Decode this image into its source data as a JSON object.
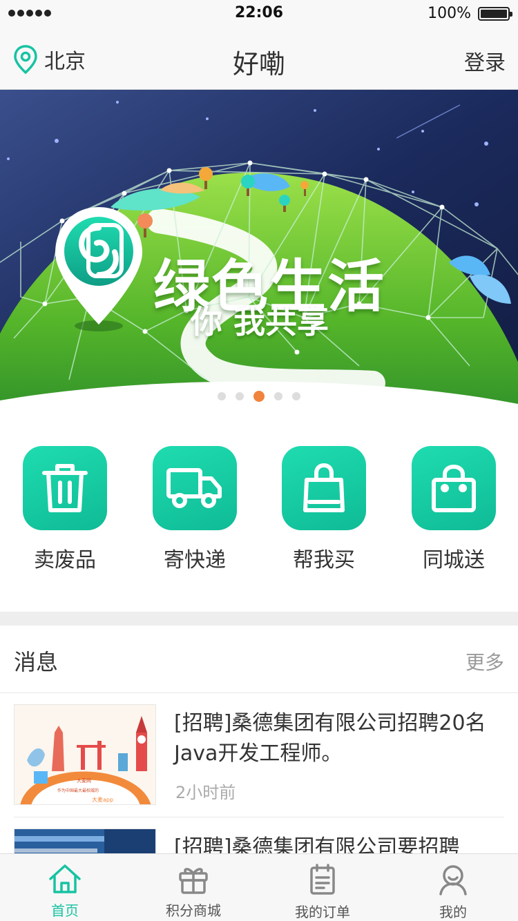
{
  "status_bar": {
    "time": "22:06",
    "battery": "100%"
  },
  "nav": {
    "location": "北京",
    "title": "好嘞",
    "login": "登录"
  },
  "banner": {
    "headline": "绿色生活",
    "subline": "你 我共享",
    "dots_total": 5,
    "active_dot": 3
  },
  "services": [
    {
      "label": "卖废品",
      "icon": "trash-icon"
    },
    {
      "label": "寄快递",
      "icon": "truck-icon"
    },
    {
      "label": "帮我买",
      "icon": "shopping-bag-icon"
    },
    {
      "label": "同城送",
      "icon": "box-bag-icon"
    }
  ],
  "messages": {
    "title": "消息",
    "more": "更多",
    "items": [
      {
        "text": "[招聘]桑德集团有限公司招聘20名Java开发工程师。",
        "time": "2小时前"
      },
      {
        "text": "[招聘]桑德集团有限公司要招聘",
        "time": ""
      }
    ]
  },
  "tabbar": {
    "active": "首页",
    "items": [
      {
        "label": "首页",
        "icon": "home-icon"
      },
      {
        "label": "积分商城",
        "icon": "gift-icon"
      },
      {
        "label": "我的订单",
        "icon": "order-list-icon"
      },
      {
        "label": "我的",
        "icon": "user-icon"
      }
    ]
  },
  "colors": {
    "accent": "#17c3a2",
    "active_dot": "#f0843c",
    "banner_green": "#5fc42c",
    "sky": "#1b2a5c"
  }
}
